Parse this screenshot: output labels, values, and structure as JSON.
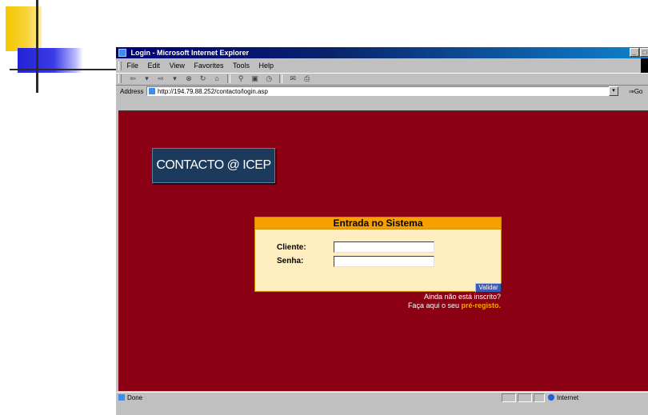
{
  "window": {
    "title": "Login - Microsoft Internet Explorer",
    "controls": [
      "_",
      "□",
      "×"
    ]
  },
  "menu": [
    "File",
    "Edit",
    "View",
    "Favorites",
    "Tools",
    "Help"
  ],
  "address": {
    "label": "Address",
    "url": "http://194.79.88.252/contacto/login.asp",
    "go_label": "Go"
  },
  "logo": {
    "text": "CONTACTO @ ICEP"
  },
  "login": {
    "title": "Entrada no Sistema",
    "cliente_label": "Cliente:",
    "senha_label": "Senha:",
    "cliente_value": "",
    "senha_value": "",
    "submit_label": "Validar",
    "note_line1": "Ainda não está inscrito?",
    "note_line2_prefix": "Faça aqui o seu ",
    "note_link": "pré-registo."
  },
  "status": {
    "text": "Done",
    "zone": "Internet"
  },
  "colors": {
    "page_bg": "#8b0012",
    "login_header": "#f5a000",
    "login_bg": "#ffefc0",
    "link": "#ffa500",
    "titlebar": "#00007b"
  }
}
